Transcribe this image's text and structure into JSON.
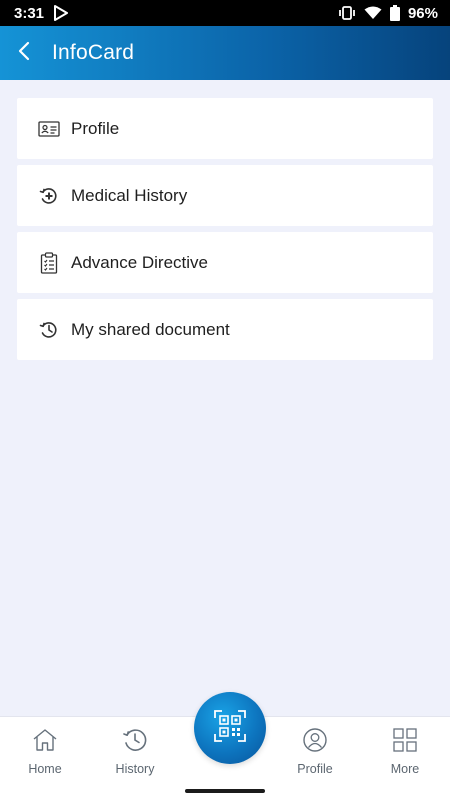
{
  "status_bar": {
    "time": "3:31",
    "battery": "96%"
  },
  "app_bar": {
    "title": "InfoCard"
  },
  "menu": [
    {
      "label": "Profile",
      "icon": "id-card-icon"
    },
    {
      "label": "Medical History",
      "icon": "medical-history-icon"
    },
    {
      "label": "Advance Directive",
      "icon": "clipboard-list-icon"
    },
    {
      "label": "My shared document",
      "icon": "history-clock-icon"
    }
  ],
  "bottom_nav": {
    "home": "Home",
    "history": "History",
    "profile": "Profile",
    "more": "More"
  },
  "colors": {
    "app_bar_start": "#1593d6",
    "app_bar_end": "#06437c",
    "background": "#eff1fb",
    "qr_button": "#0d75bf"
  }
}
